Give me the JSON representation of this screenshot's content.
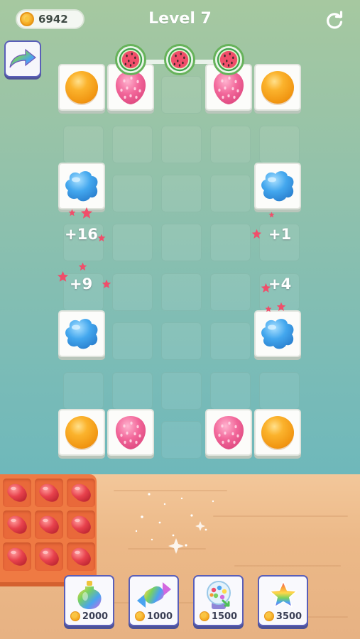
{
  "header": {
    "coins": "6942",
    "level_title": "Level 7",
    "restart_icon": "restart-icon",
    "undo_icon": "rainbow-arrow-icon"
  },
  "collected_slots": [
    "watermelon",
    "watermelon",
    "watermelon"
  ],
  "board": {
    "columns": 5,
    "rows": 8,
    "tiles": [
      {
        "row": 0,
        "col": 0,
        "item": "orange"
      },
      {
        "row": 0,
        "col": 1,
        "item": "strawberry"
      },
      {
        "row": 0,
        "col": 3,
        "item": "strawberry"
      },
      {
        "row": 0,
        "col": 4,
        "item": "orange"
      },
      {
        "row": 2,
        "col": 0,
        "item": "blue-jelly"
      },
      {
        "row": 2,
        "col": 4,
        "item": "blue-jelly"
      },
      {
        "row": 5,
        "col": 0,
        "item": "blue-jelly"
      },
      {
        "row": 5,
        "col": 4,
        "item": "blue-jelly"
      },
      {
        "row": 7,
        "col": 0,
        "item": "orange"
      },
      {
        "row": 7,
        "col": 1,
        "item": "strawberry"
      },
      {
        "row": 7,
        "col": 3,
        "item": "strawberry"
      },
      {
        "row": 7,
        "col": 4,
        "item": "orange"
      }
    ]
  },
  "score_popups": [
    "+16",
    "+1",
    "+9",
    "+4"
  ],
  "tray": {
    "item": "red-jelly-bean",
    "count": 9
  },
  "boosters": [
    {
      "name": "rainbow-potion",
      "price": "2000"
    },
    {
      "name": "rainbow-candy",
      "price": "1000"
    },
    {
      "name": "gumball-machine",
      "price": "1500"
    },
    {
      "name": "rainbow-star",
      "price": "3500"
    }
  ],
  "colors": {
    "accent": "#5a5fb8",
    "orange": "#f19612",
    "strawberry": "#f2679a",
    "blue_jelly": "#3d9de6",
    "tray": "#ef7a43"
  }
}
